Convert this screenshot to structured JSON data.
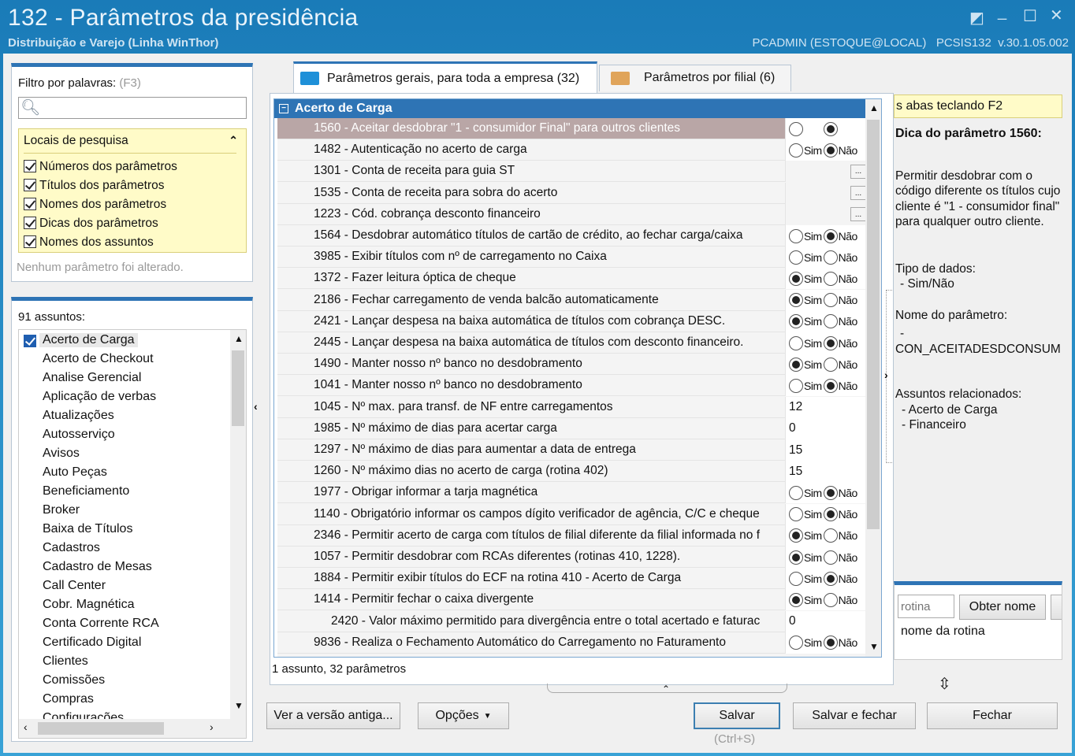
{
  "window": {
    "title": "132 - Parâmetros da presidência",
    "subtitle": "Distribuição e Varejo (Linha WinThor)",
    "user_info": "PCADMIN (ESTOQUE@LOCAL)   PCSIS132  v.30.1.05.002"
  },
  "filter": {
    "label": "Filtro por palavras:",
    "shortcut": "(F3)",
    "search_value": "",
    "locations_title": "Locais de pesquisa",
    "locations": [
      "Números dos parâmetros",
      "Títulos dos parâmetros",
      "Nomes dos parâmetros",
      "Dicas dos parâmetros",
      "Nomes dos assuntos"
    ],
    "status": "Nenhum parâmetro foi alterado."
  },
  "subjects": {
    "count_label": "91 assuntos:",
    "items": [
      "Acerto de Carga",
      "Acerto de Checkout",
      "Analise Gerencial",
      "Aplicação de verbas",
      "Atualizações",
      "Autosserviço",
      "Avisos",
      "Auto Peças",
      "Beneficiamento",
      "Broker",
      "Baixa de Títulos",
      "Cadastros",
      "Cadastro de Mesas",
      "Call Center",
      "Cobr. Magnética",
      "Conta Corrente RCA",
      "Certificado Digital",
      "Clientes",
      "Comissões",
      "Compras",
      "Configurações"
    ]
  },
  "tabs": [
    {
      "label": "Parâmetros gerais, para toda a empresa  (32)"
    },
    {
      "label": "Parâmetros por filial  (6)"
    }
  ],
  "grid": {
    "group_title": "Acerto de Carga",
    "yes_label": "Sim",
    "no_label": "Não",
    "rows": [
      {
        "label": "1560 - Aceitar desdobrar \"1 - consumidor Final\" para outros clientes",
        "type": "radio",
        "value": "Não",
        "selected": true
      },
      {
        "label": "1482 - Autenticação no acerto de carga",
        "type": "radio",
        "value": "Não"
      },
      {
        "label": "1301 - Conta de receita para guia ST",
        "type": "lookup",
        "value": "..."
      },
      {
        "label": "1535 - Conta de receita para sobra do acerto",
        "type": "lookup",
        "value": "..."
      },
      {
        "label": "1223 - Cód. cobrança desconto financeiro",
        "type": "lookup",
        "value": "..."
      },
      {
        "label": "1564 - Desdobrar automático títulos de cartão de crédito, ao fechar carga/caixa",
        "type": "radio",
        "value": "Não"
      },
      {
        "label": "3985 - Exibir títulos com nº de carregamento no Caixa",
        "type": "radio",
        "value": ""
      },
      {
        "label": "1372 - Fazer leitura óptica de cheque",
        "type": "radio",
        "value": "Sim"
      },
      {
        "label": "2186 - Fechar carregamento de venda balcão automaticamente",
        "type": "radio",
        "value": "Sim"
      },
      {
        "label": "2421 - Lançar despesa na baixa automática de títulos com cobrança DESC.",
        "type": "radio",
        "value": "Sim"
      },
      {
        "label": "2445 - Lançar despesa na baixa automática de títulos com desconto financeiro.",
        "type": "radio",
        "value": "Não"
      },
      {
        "label": "1490 - Manter nosso nº banco no desdobramento",
        "type": "radio",
        "value": "Sim"
      },
      {
        "label": "1041 - Manter nosso nº banco no desdobramento",
        "type": "radio",
        "value": "Não"
      },
      {
        "label": "1045 - Nº max. para transf. de NF entre carregamentos",
        "type": "text",
        "value": "12"
      },
      {
        "label": "1985 - Nº máximo de dias para acertar carga",
        "type": "text",
        "value": "0"
      },
      {
        "label": "1297 - Nº máximo de dias para aumentar a data de entrega",
        "type": "text",
        "value": "15"
      },
      {
        "label": "1260 - Nº máximo dias no acerto de carga (rotina 402)",
        "type": "text",
        "value": "15"
      },
      {
        "label": "1977 - Obrigar informar a tarja magnética",
        "type": "radio",
        "value": "Não"
      },
      {
        "label": "1140 - Obrigatório informar os campos dígito verificador de agência, C/C e cheque",
        "type": "radio",
        "value": "Não"
      },
      {
        "label": "2346 - Permitir acerto de carga com títulos de filial diferente da filial informada no f",
        "type": "radio",
        "value": "Sim"
      },
      {
        "label": "1057 - Permitir desdobrar com RCAs diferentes (rotinas 410, 1228).",
        "type": "radio",
        "value": "Sim"
      },
      {
        "label": "1884 - Permitir exibir títulos do ECF na rotina 410 - Acerto de Carga",
        "type": "radio",
        "value": "Não"
      },
      {
        "label": "1414 - Permitir fechar o caixa divergente",
        "type": "radio",
        "value": "Sim"
      },
      {
        "label": "2420 - Valor máximo permitido para divergência entre o total acertado e faturac",
        "type": "text",
        "value": "0",
        "indent": true
      },
      {
        "label": "9836 - Realiza o Fechamento Automático do Carregamento no Faturamento",
        "type": "radio",
        "value": "Não"
      }
    ],
    "footer": "1 assunto, 32 parâmetros"
  },
  "tip": {
    "banner": "s abas teclando F2",
    "title": "Dica do parâmetro 1560:",
    "description": "Permitir desdobrar com o código diferente os títulos cujo cliente é \"1 - consumidor final\" para qualquer outro cliente.",
    "data_type_label": "Tipo de dados:",
    "data_type_value": "- Sim/Não",
    "param_name_label": "Nome do parâmetro:",
    "param_name_dash": "-",
    "param_name_value": "CON_ACEITADESDCONSUMI",
    "related_label": "Assuntos relacionados:",
    "related": [
      "- Acerto de Carga",
      "- Financeiro"
    ]
  },
  "routine": {
    "placeholder": "rotina",
    "get_name_label": "Obter nome",
    "name_label": "nome da rotina"
  },
  "buttons": {
    "old_version": "Ver a versão antiga...",
    "options": "Opções",
    "save": "Salvar",
    "save_hint": "(Ctrl+S)",
    "save_close": "Salvar e fechar",
    "close": "Fechar"
  }
}
